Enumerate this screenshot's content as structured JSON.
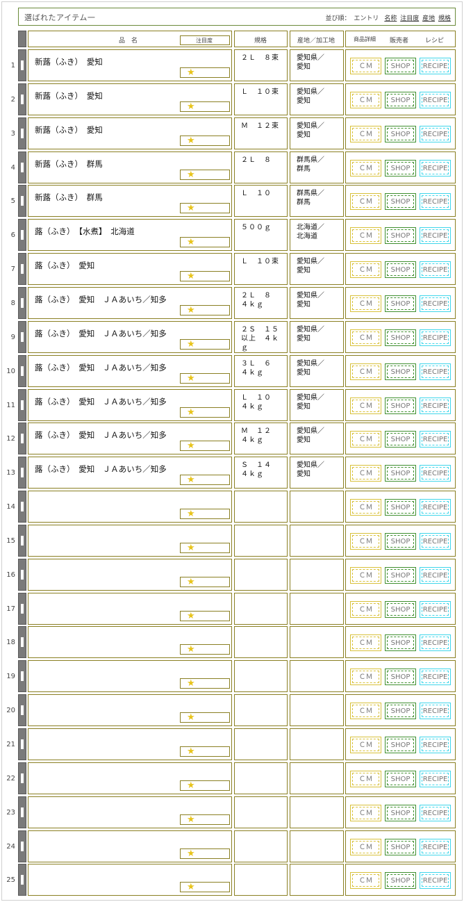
{
  "header": {
    "title": "選ばれたアイテム一",
    "sort_label": "並び順：",
    "sort_options": [
      "エントリ",
      "名称",
      "注目度",
      "産地",
      "規格"
    ]
  },
  "table_header": {
    "name": "品　名",
    "attention": "注目度",
    "spec": "規格",
    "origin": "産地／加工地",
    "detail": "商品詳細",
    "seller": "販売者",
    "recipe": "レシピ"
  },
  "buttons": {
    "cm": "ＣＭ",
    "shop": "SHOP",
    "recipe": "RECIPE"
  },
  "rows": [
    {
      "num": "1",
      "name": "新蕗（ふき）　愛知",
      "spec": "２Ｌ　８束",
      "origin": "愛知県／\n愛知"
    },
    {
      "num": "2",
      "name": "新蕗（ふき）　愛知",
      "spec": "Ｌ　１０束",
      "origin": "愛知県／\n愛知"
    },
    {
      "num": "3",
      "name": "新蕗（ふき）　愛知",
      "spec": "Ｍ　１２束",
      "origin": "愛知県／\n愛知"
    },
    {
      "num": "4",
      "name": "新蕗（ふき）　群馬",
      "spec": "２Ｌ　８",
      "origin": "群馬県／\n群馬"
    },
    {
      "num": "5",
      "name": "新蕗（ふき）　群馬",
      "spec": "Ｌ　１０",
      "origin": "群馬県／\n群馬"
    },
    {
      "num": "6",
      "name": "蕗（ふき）　【水煮】　北海道",
      "spec": "５００ｇ",
      "origin": "北海道／\n北海道"
    },
    {
      "num": "7",
      "name": "蕗（ふき）　愛知",
      "spec": "Ｌ　１０束",
      "origin": "愛知県／\n愛知"
    },
    {
      "num": "8",
      "name": "蕗（ふき）　愛知　ＪＡあいち／知多",
      "spec": "２Ｌ　８\n４ｋｇ",
      "origin": "愛知県／\n愛知"
    },
    {
      "num": "9",
      "name": "蕗（ふき）　愛知　ＪＡあいち／知多",
      "spec": "２Ｓ　１５\n以上　４ｋ\nｇ",
      "origin": "愛知県／\n愛知"
    },
    {
      "num": "10",
      "name": "蕗（ふき）　愛知　ＪＡあいち／知多",
      "spec": "３Ｌ　６\n４ｋｇ",
      "origin": "愛知県／\n愛知"
    },
    {
      "num": "11",
      "name": "蕗（ふき）　愛知　ＪＡあいち／知多",
      "spec": "Ｌ　１０\n４ｋｇ",
      "origin": "愛知県／\n愛知"
    },
    {
      "num": "12",
      "name": "蕗（ふき）　愛知　ＪＡあいち／知多",
      "spec": "Ｍ　１２\n４ｋｇ",
      "origin": "愛知県／\n愛知"
    },
    {
      "num": "13",
      "name": "蕗（ふき）　愛知　ＪＡあいち／知多",
      "spec": "Ｓ　１４\n４ｋｇ",
      "origin": "愛知県／\n愛知"
    },
    {
      "num": "14",
      "name": "",
      "spec": "",
      "origin": ""
    },
    {
      "num": "15",
      "name": "",
      "spec": "",
      "origin": ""
    },
    {
      "num": "16",
      "name": "",
      "spec": "",
      "origin": ""
    },
    {
      "num": "17",
      "name": "",
      "spec": "",
      "origin": ""
    },
    {
      "num": "18",
      "name": "",
      "spec": "",
      "origin": ""
    },
    {
      "num": "19",
      "name": "",
      "spec": "",
      "origin": ""
    },
    {
      "num": "20",
      "name": "",
      "spec": "",
      "origin": ""
    },
    {
      "num": "21",
      "name": "",
      "spec": "",
      "origin": ""
    },
    {
      "num": "22",
      "name": "",
      "spec": "",
      "origin": ""
    },
    {
      "num": "23",
      "name": "",
      "spec": "",
      "origin": ""
    },
    {
      "num": "24",
      "name": "",
      "spec": "",
      "origin": ""
    },
    {
      "num": "25",
      "name": "",
      "spec": "",
      "origin": ""
    }
  ],
  "star_icon": "star-icon",
  "colors": {
    "border": "#8a7f22",
    "star": "#e8c41c",
    "cm": "#d8c13a",
    "shop": "#3e8f2e",
    "recipe": "#3fd6ea",
    "row_bar": "#7a7a7a"
  }
}
